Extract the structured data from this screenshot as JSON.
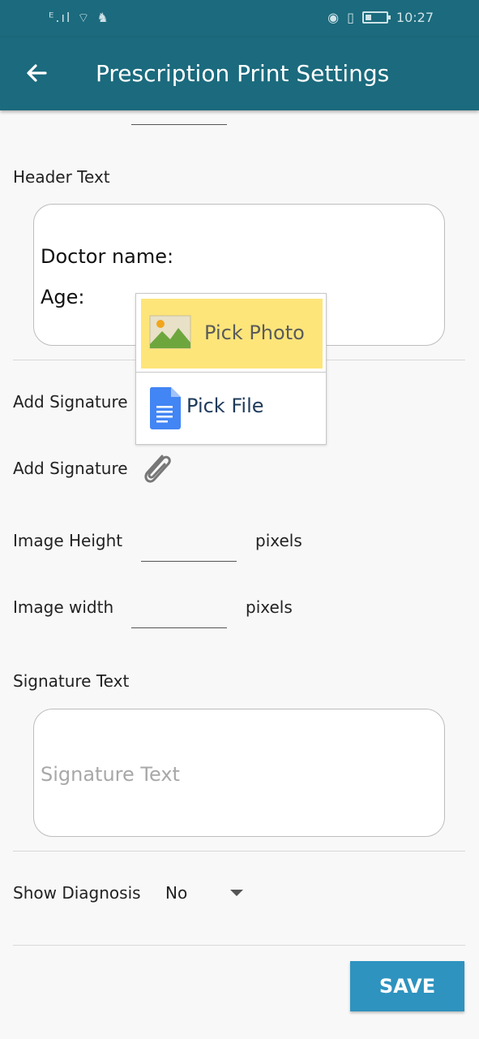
{
  "status_bar": {
    "left_icons": "ᴱ.ıl ⌔ ♞",
    "time": "10:27"
  },
  "appbar": {
    "title": "Prescription Print Settings"
  },
  "form": {
    "header_text_label": "Header Text",
    "header_lines": [
      "Doctor name:",
      "Age:"
    ],
    "add_signature_label_1": "Add Signature",
    "add_signature_label_2": "Add Signature",
    "image_height_label": "Image Height",
    "image_height_unit": "pixels",
    "image_width_label": "Image width",
    "image_width_unit": "pixels",
    "signature_text_label": "Signature Text",
    "signature_text_placeholder": "Signature Text",
    "show_diagnosis_label": "Show Diagnosis",
    "show_diagnosis_value": "No",
    "save_label": "SAVE"
  },
  "popup": {
    "items": [
      {
        "label": "Pick Photo",
        "icon": "image-icon"
      },
      {
        "label": "Pick File",
        "icon": "document-icon"
      }
    ]
  },
  "colors": {
    "appbar": "#1b6a7d",
    "save_button": "#2e93bf",
    "highlight": "#fde57a"
  }
}
